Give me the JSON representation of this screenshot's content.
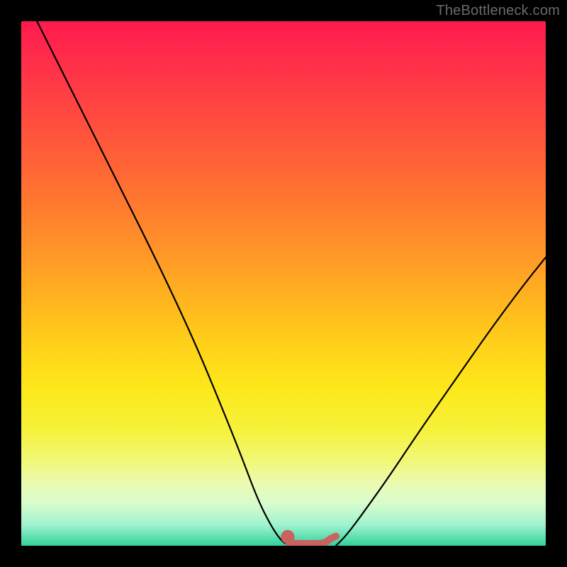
{
  "watermark": {
    "text": "TheBottleneck.com"
  },
  "chart_data": {
    "type": "line",
    "title": "",
    "xlabel": "",
    "ylabel": "",
    "xlim": [
      0,
      100
    ],
    "ylim": [
      0,
      100
    ],
    "grid": false,
    "legend": false,
    "series": [
      {
        "name": "left-curve",
        "x": [
          3,
          10,
          18,
          26,
          33,
          38,
          42,
          45,
          47.5,
          49.5,
          51
        ],
        "y": [
          100,
          86,
          70,
          54,
          39,
          27,
          17,
          9,
          4,
          1,
          0
        ],
        "stroke": "#000000"
      },
      {
        "name": "right-curve",
        "x": [
          60,
          62,
          65,
          70,
          76,
          83,
          90,
          96,
          100
        ],
        "y": [
          0,
          2,
          6,
          13,
          22,
          32,
          42,
          50,
          55
        ],
        "stroke": "#000000"
      },
      {
        "name": "bottom-accent",
        "x": [
          51,
          53,
          55,
          57,
          58,
          59,
          60
        ],
        "y": [
          0.5,
          0.4,
          0.4,
          0.4,
          0.6,
          1.4,
          1.8
        ],
        "stroke": "#c9635f"
      }
    ],
    "markers": [
      {
        "name": "left-dot",
        "x": 50.8,
        "y": 1.7,
        "r": 1.0,
        "fill": "#c9635f"
      }
    ],
    "background_gradient": {
      "direction": "vertical",
      "stops": [
        {
          "pct": 0,
          "color": "#ff1a4d"
        },
        {
          "pct": 50,
          "color": "#ffb020"
        },
        {
          "pct": 78,
          "color": "#f6f23b"
        },
        {
          "pct": 100,
          "color": "#33d19a"
        }
      ]
    }
  }
}
